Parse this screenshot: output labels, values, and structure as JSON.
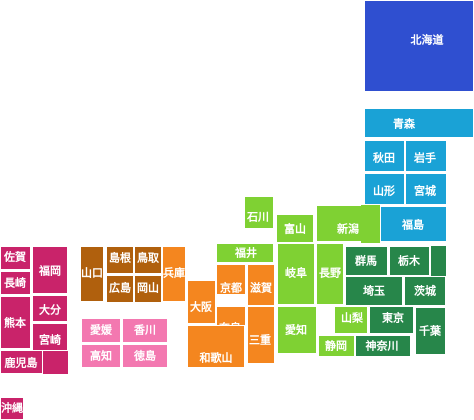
{
  "colors": {
    "hokkaido": "#2f4fd0",
    "tohoku": "#1aa2d6",
    "kanto": "#27864a",
    "chubu": "#7fd133",
    "kinki": "#f4861f",
    "chugoku": "#b0600d",
    "shikoku": "#f378b0",
    "kyushu": "#c9236a"
  },
  "prefectures": {
    "hokkaido": {
      "name": "北海道",
      "region": "hokkaido"
    },
    "aomori": {
      "name": "青森",
      "region": "tohoku"
    },
    "akita": {
      "name": "秋田",
      "region": "tohoku"
    },
    "iwate": {
      "name": "岩手",
      "region": "tohoku"
    },
    "yamagata": {
      "name": "山形",
      "region": "tohoku"
    },
    "miyagi": {
      "name": "宮城",
      "region": "tohoku"
    },
    "fukushima": {
      "name": "福島",
      "region": "tohoku"
    },
    "niigata": {
      "name": "新潟",
      "region": "chubu"
    },
    "toyama": {
      "name": "富山",
      "region": "chubu"
    },
    "ishikawa": {
      "name": "石川",
      "region": "chubu"
    },
    "fukui": {
      "name": "福井",
      "region": "chubu"
    },
    "nagano": {
      "name": "長野",
      "region": "chubu"
    },
    "gifu": {
      "name": "岐阜",
      "region": "chubu"
    },
    "aichi": {
      "name": "愛知",
      "region": "chubu"
    },
    "shizuoka": {
      "name": "静岡",
      "region": "chubu"
    },
    "yamanashi": {
      "name": "山梨",
      "region": "chubu"
    },
    "gunma": {
      "name": "群馬",
      "region": "kanto"
    },
    "tochigi": {
      "name": "栃木",
      "region": "kanto"
    },
    "ibaraki": {
      "name": "茨城",
      "region": "kanto"
    },
    "saitama": {
      "name": "埼玉",
      "region": "kanto"
    },
    "tokyo": {
      "name": "東京",
      "region": "kanto"
    },
    "kanagawa": {
      "name": "神奈川",
      "region": "kanto"
    },
    "chiba": {
      "name": "千葉",
      "region": "kanto"
    },
    "kyoto": {
      "name": "京都",
      "region": "kinki"
    },
    "shiga": {
      "name": "滋賀",
      "region": "kinki"
    },
    "hyogo": {
      "name": "兵庫",
      "region": "kinki"
    },
    "osaka": {
      "name": "大阪",
      "region": "kinki"
    },
    "nara": {
      "name": "奈良",
      "region": "kinki"
    },
    "mie": {
      "name": "三重",
      "region": "kinki"
    },
    "wakayama": {
      "name": "和歌山",
      "region": "kinki"
    },
    "yamaguchi": {
      "name": "山口",
      "region": "chugoku"
    },
    "shimane": {
      "name": "島根",
      "region": "chugoku"
    },
    "tottori": {
      "name": "鳥取",
      "region": "chugoku"
    },
    "hiroshima": {
      "name": "広島",
      "region": "chugoku"
    },
    "okayama": {
      "name": "岡山",
      "region": "chugoku"
    },
    "ehime": {
      "name": "愛媛",
      "region": "shikoku"
    },
    "kagawa": {
      "name": "香川",
      "region": "shikoku"
    },
    "kochi": {
      "name": "高知",
      "region": "shikoku"
    },
    "tokushima": {
      "name": "徳島",
      "region": "shikoku"
    },
    "saga": {
      "name": "佐賀",
      "region": "kyushu"
    },
    "fukuoka": {
      "name": "福岡",
      "region": "kyushu"
    },
    "nagasaki": {
      "name": "長崎",
      "region": "kyushu"
    },
    "oita": {
      "name": "大分",
      "region": "kyushu"
    },
    "kumamoto": {
      "name": "熊本",
      "region": "kyushu"
    },
    "miyazaki": {
      "name": "宮崎",
      "region": "kyushu"
    },
    "kagoshima": {
      "name": "鹿児島",
      "region": "kyushu"
    },
    "okinawa": {
      "name": "沖縄",
      "region": "kyushu"
    }
  }
}
